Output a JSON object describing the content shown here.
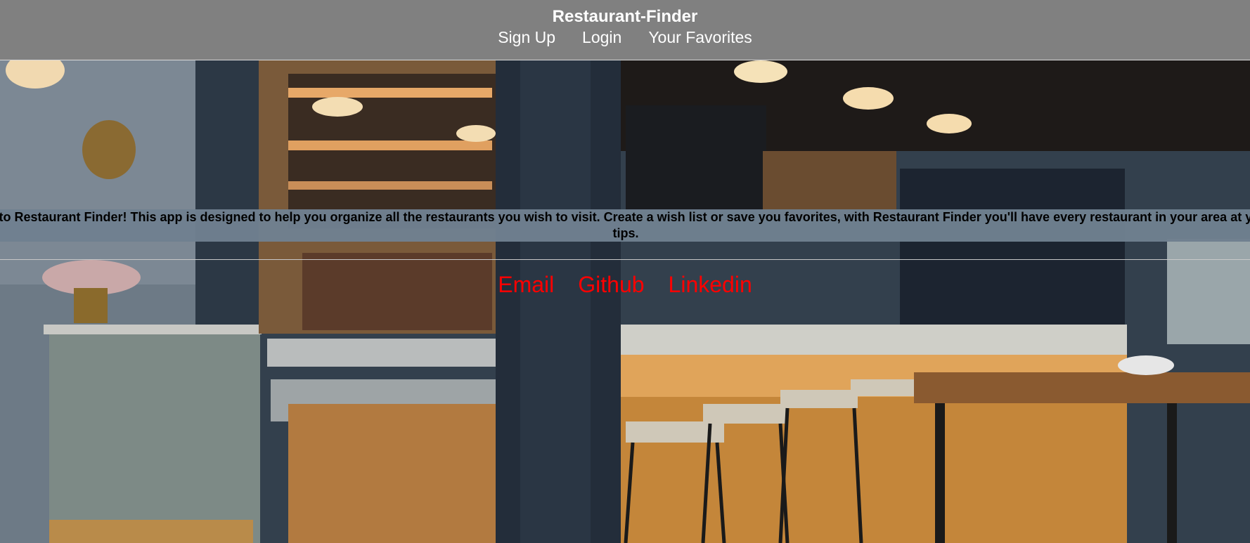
{
  "header": {
    "title": "Restaurant-Finder",
    "nav": [
      {
        "label": "Sign Up"
      },
      {
        "label": "Login"
      },
      {
        "label": "Your Favorites"
      }
    ]
  },
  "welcome_text": "Welcome to Restaurant Finder! This app is designed to help you organize all the restaurants you wish to visit. Create a wish list or save you favorites, with Restaurant Finder you'll have every restaurant in your area at your finger tips.",
  "footer_links": [
    {
      "label": "Email"
    },
    {
      "label": "Github"
    },
    {
      "label": "Linkedin"
    }
  ],
  "colors": {
    "header_bg": "#808080",
    "banner_bg": "#708090",
    "link_red": "#ff0000"
  }
}
